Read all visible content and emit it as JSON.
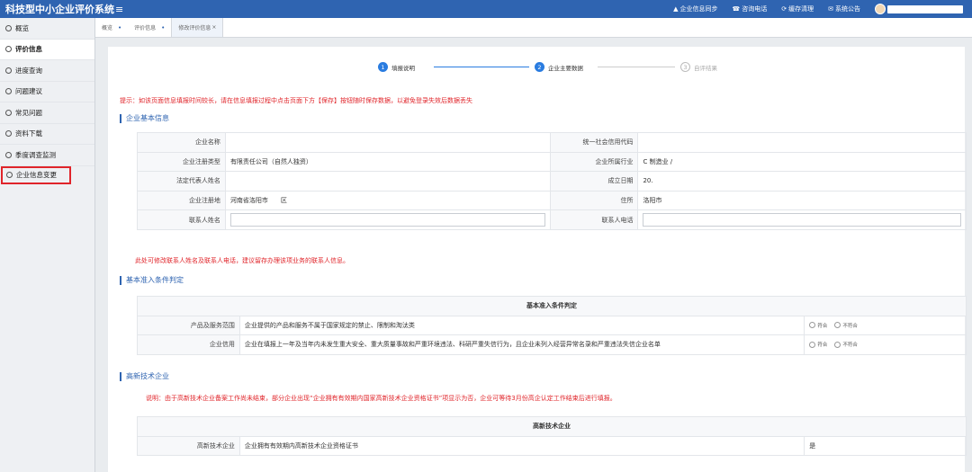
{
  "app": {
    "title": "科技型中小企业评价系统",
    "menu_icon": "menu-icon"
  },
  "top_actions": [
    {
      "icon": "user-icon",
      "glyph": "▲",
      "label": "企业信息同步"
    },
    {
      "icon": "phone-icon",
      "glyph": "☎",
      "label": "咨询电话"
    },
    {
      "icon": "clean-icon",
      "glyph": "⟳",
      "label": "缓存清理"
    },
    {
      "icon": "notice-icon",
      "glyph": "✉",
      "label": "系统公告"
    }
  ],
  "sidebar": {
    "items": [
      {
        "label": "概览"
      },
      {
        "label": "评价信息"
      },
      {
        "label": "进度查询"
      },
      {
        "label": "问题建议"
      },
      {
        "label": "常见问题"
      },
      {
        "label": "资料下载"
      },
      {
        "label": "季度调查监测"
      },
      {
        "label": "企业信息变更"
      }
    ]
  },
  "tabs": [
    {
      "label": "概览"
    },
    {
      "label": "评价信息"
    },
    {
      "label": "修改评价信息",
      "close": "×"
    }
  ],
  "steps": [
    {
      "num": "1",
      "label": "填报说明"
    },
    {
      "num": "2",
      "label": "企业主要数据"
    },
    {
      "num": "3",
      "label": "自评结果"
    }
  ],
  "tip": "提示：如该页面信息填报时间较长，请在信息填报过程中点击页面下方【保存】按钮随时保存数据，以避免登录失效后数据丢失",
  "basic_info": {
    "title": "企业基本信息",
    "rows": [
      {
        "l1": "企业名称",
        "v1": "",
        "l2": "统一社会信用代码",
        "v2": ""
      },
      {
        "l1": "企业注册类型",
        "v1": "有限责任公司（自然人独资）",
        "l2": "企业所属行业",
        "v2": "C 制造业 /"
      },
      {
        "l1": "法定代表人姓名",
        "v1": "",
        "l2": "成立日期",
        "v2": "20."
      },
      {
        "l1": "企业注册地",
        "v1": "河南省洛阳市　　区",
        "l2": "住所",
        "v2": "洛阳市"
      },
      {
        "l1": "联系人姓名",
        "v1": "",
        "l2": "联系人电话",
        "v2": ""
      }
    ],
    "note": "此处可修改联系人姓名及联系人电话，建议留存办理该项业务的联系人信息。"
  },
  "admission": {
    "title": "基本准入条件判定",
    "table_head": "基本准入条件判定",
    "rows": [
      {
        "label": "产品及服务范围",
        "text": "企业提供的产品和服务不属于国家规定的禁止、限制和淘汰类",
        "opt1": "符合",
        "opt2": "不符合"
      },
      {
        "label": "企业信用",
        "text": "企业在填报上一年及当年内未发生重大安全、重大质量事故和严重环境违法、科研严重失信行为，且企业未列入经营异常名录和严重违法失信企业名单",
        "opt1": "符合",
        "opt2": "不符合"
      }
    ]
  },
  "hightech": {
    "title": "高新技术企业",
    "note": "说明：由于高新技术企业备案工作尚未结束，部分企业出现“企业拥有有效期内国家高新技术企业资格证书”项显示为否，企业可等待3月份高企认定工作结束后进行填报。",
    "table_head": "高新技术企业",
    "row": {
      "label": "高新技术企业",
      "text": "企业拥有有效期内高新技术企业资格证书",
      "value": "是"
    }
  }
}
